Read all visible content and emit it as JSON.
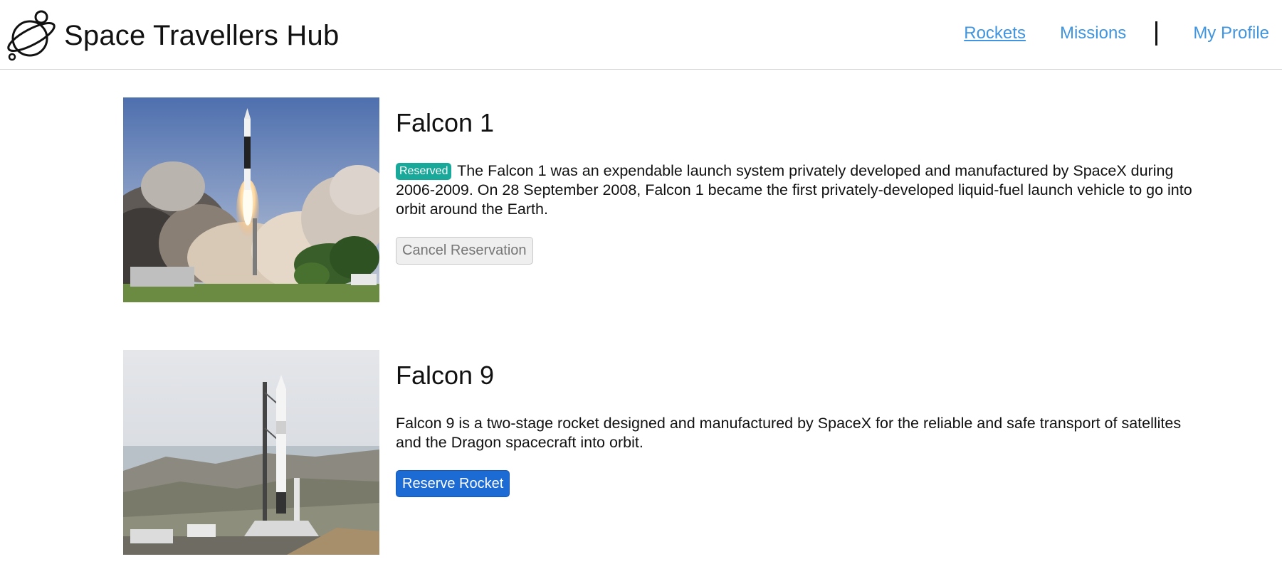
{
  "header": {
    "title": "Space Travellers Hub",
    "logo_icon": "planet-icon",
    "nav": {
      "rockets": "Rockets",
      "missions": "Missions",
      "profile": "My Profile"
    },
    "active_nav": "Rockets"
  },
  "rockets": [
    {
      "name": "Falcon 1",
      "badge": "Reserved",
      "description": "The Falcon 1 was an expendable launch system privately developed and manufactured by SpaceX during 2006-2009. On 28 September 2008, Falcon 1 became the first privately-developed liquid-fuel launch vehicle to go into orbit around the Earth.",
      "button": "Cancel Reservation",
      "reserved": true
    },
    {
      "name": "Falcon 9",
      "description": "Falcon 9 is a two-stage rocket designed and manufactured by SpaceX for the reliable and safe transport of satellites and the Dragon spacecraft into orbit.",
      "button": "Reserve Rocket",
      "reserved": false
    }
  ],
  "colors": {
    "link": "#3f95e0",
    "badge": "#18a99a",
    "reserve_button": "#1c6ad4"
  }
}
